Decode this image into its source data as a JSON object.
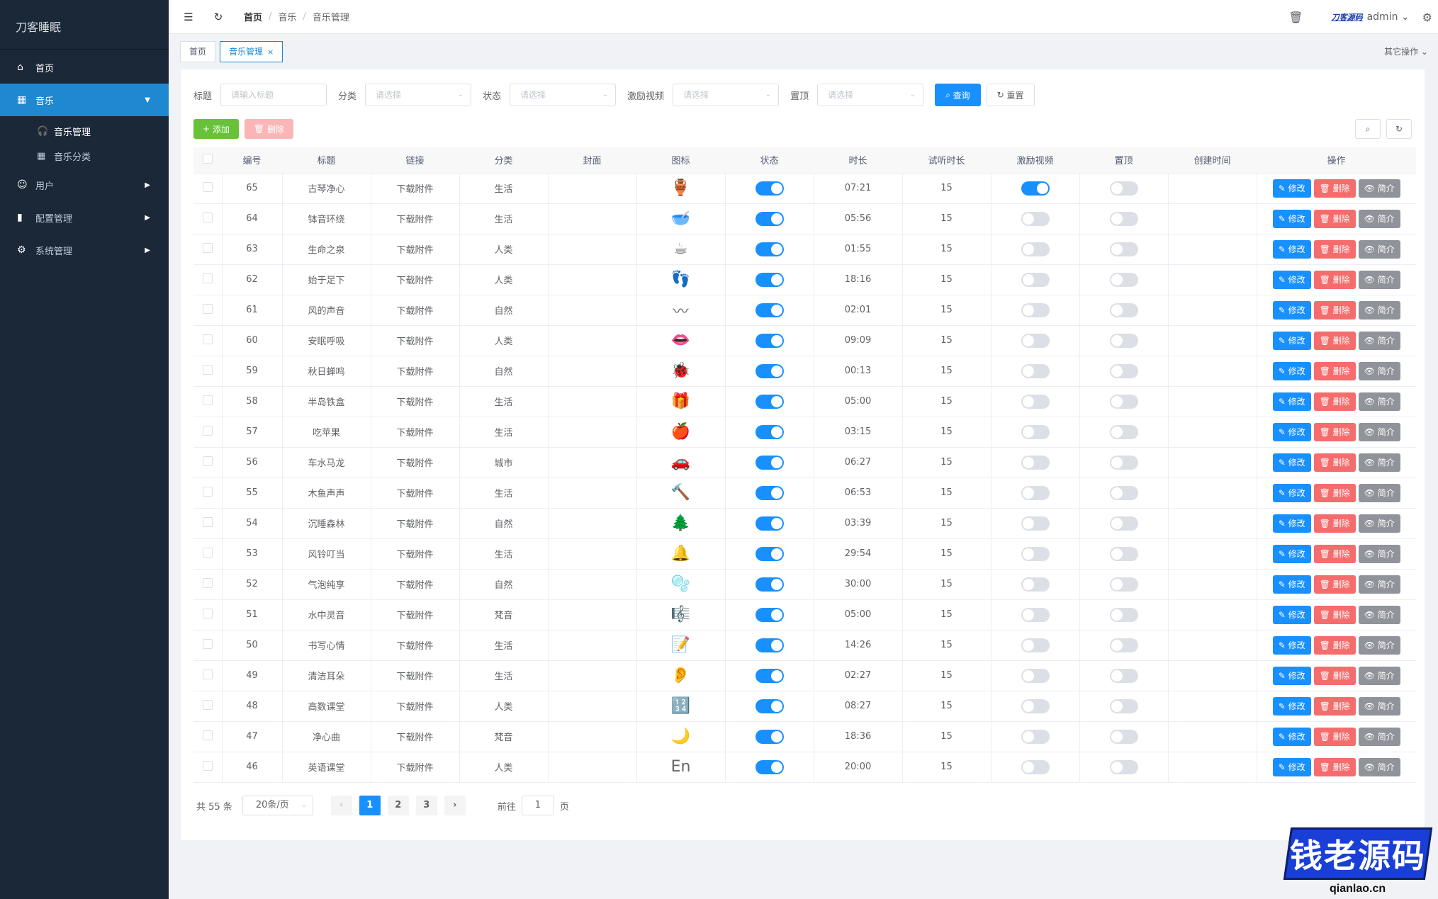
{
  "sidebar": {
    "logo": "刀客睡眠",
    "items": [
      {
        "label": "首页",
        "icon": "home-icon"
      },
      {
        "label": "音乐",
        "icon": "grid-icon"
      },
      {
        "label": "用户",
        "icon": "user-icon"
      },
      {
        "label": "配置管理",
        "icon": "bar-chart-icon"
      },
      {
        "label": "系统管理",
        "icon": "gear-icon"
      }
    ],
    "sub_items": [
      {
        "label": "音乐管理",
        "icon": "headphones-icon"
      },
      {
        "label": "音乐分类",
        "icon": "table-icon"
      }
    ]
  },
  "header": {
    "breadcrumb": [
      "首页",
      "音乐",
      "音乐管理"
    ],
    "brand": "刀客源码",
    "user": "admin"
  },
  "tags": {
    "items": [
      "首页",
      "音乐管理"
    ],
    "other_ops": "其它操作"
  },
  "filter": {
    "title_label": "标题",
    "title_placeholder": "请输入标题",
    "category_label": "分类",
    "status_label": "状态",
    "video_label": "激励视频",
    "top_label": "置顶",
    "select_placeholder": "请选择",
    "search_btn": "查询",
    "reset_btn": "重置"
  },
  "toolbar": {
    "add_btn": "添加",
    "delete_btn": "删除"
  },
  "table": {
    "headers": [
      "编号",
      "标题",
      "链接",
      "分类",
      "封面",
      "图标",
      "状态",
      "时长",
      "试听时长",
      "激励视频",
      "置顶",
      "创建时间",
      "操作"
    ],
    "link_text": "下载附件",
    "edit_btn": "修改",
    "delete_btn": "删除",
    "info_btn": "简介",
    "rows": [
      {
        "id": "65",
        "title": "古琴净心",
        "cat": "生活",
        "icon": "🏺",
        "status": true,
        "dur": "07:21",
        "trial": "15",
        "video": true,
        "top": false
      },
      {
        "id": "64",
        "title": "钵音环绕",
        "cat": "生活",
        "icon": "🥣",
        "status": true,
        "dur": "05:56",
        "trial": "15",
        "video": false,
        "top": false
      },
      {
        "id": "63",
        "title": "生命之泉",
        "cat": "人类",
        "icon": "☕",
        "status": true,
        "dur": "01:55",
        "trial": "15",
        "video": false,
        "top": false
      },
      {
        "id": "62",
        "title": "始于足下",
        "cat": "人类",
        "icon": "👣",
        "status": true,
        "dur": "18:16",
        "trial": "15",
        "video": false,
        "top": false
      },
      {
        "id": "61",
        "title": "风的声音",
        "cat": "自然",
        "icon": "〰",
        "status": true,
        "dur": "02:01",
        "trial": "15",
        "video": false,
        "top": false
      },
      {
        "id": "60",
        "title": "安眠呼吸",
        "cat": "人类",
        "icon": "👄",
        "status": true,
        "dur": "09:09",
        "trial": "15",
        "video": false,
        "top": false
      },
      {
        "id": "59",
        "title": "秋日蝉鸣",
        "cat": "自然",
        "icon": "🐞",
        "status": true,
        "dur": "00:13",
        "trial": "15",
        "video": false,
        "top": false
      },
      {
        "id": "58",
        "title": "半岛铁盒",
        "cat": "生活",
        "icon": "🎁",
        "status": true,
        "dur": "05:00",
        "trial": "15",
        "video": false,
        "top": false
      },
      {
        "id": "57",
        "title": "吃苹果",
        "cat": "生活",
        "icon": "🍎",
        "status": true,
        "dur": "03:15",
        "trial": "15",
        "video": false,
        "top": false
      },
      {
        "id": "56",
        "title": "车水马龙",
        "cat": "城市",
        "icon": "🚗",
        "status": true,
        "dur": "06:27",
        "trial": "15",
        "video": false,
        "top": false
      },
      {
        "id": "55",
        "title": "木鱼声声",
        "cat": "生活",
        "icon": "🔨",
        "status": true,
        "dur": "06:53",
        "trial": "15",
        "video": false,
        "top": false
      },
      {
        "id": "54",
        "title": "沉睡森林",
        "cat": "自然",
        "icon": "🌲",
        "status": true,
        "dur": "03:39",
        "trial": "15",
        "video": false,
        "top": false
      },
      {
        "id": "53",
        "title": "风铃叮当",
        "cat": "生活",
        "icon": "🔔",
        "status": true,
        "dur": "29:54",
        "trial": "15",
        "video": false,
        "top": false
      },
      {
        "id": "52",
        "title": "气泡纯享",
        "cat": "自然",
        "icon": "🫧",
        "status": true,
        "dur": "30:00",
        "trial": "15",
        "video": false,
        "top": false
      },
      {
        "id": "51",
        "title": "水中灵音",
        "cat": "梵音",
        "icon": "🎼",
        "status": true,
        "dur": "05:00",
        "trial": "15",
        "video": false,
        "top": false
      },
      {
        "id": "50",
        "title": "书写心情",
        "cat": "生活",
        "icon": "📝",
        "status": true,
        "dur": "14:26",
        "trial": "15",
        "video": false,
        "top": false
      },
      {
        "id": "49",
        "title": "清洁耳朵",
        "cat": "生活",
        "icon": "👂",
        "status": true,
        "dur": "02:27",
        "trial": "15",
        "video": false,
        "top": false
      },
      {
        "id": "48",
        "title": "高数课堂",
        "cat": "人类",
        "icon": "🔢",
        "status": true,
        "dur": "08:27",
        "trial": "15",
        "video": false,
        "top": false
      },
      {
        "id": "47",
        "title": "净心曲",
        "cat": "梵音",
        "icon": "🌙",
        "status": true,
        "dur": "18:36",
        "trial": "15",
        "video": false,
        "top": false
      },
      {
        "id": "46",
        "title": "英语课堂",
        "cat": "人类",
        "icon": "En",
        "status": true,
        "dur": "20:00",
        "trial": "15",
        "video": false,
        "top": false
      }
    ]
  },
  "pagination": {
    "total": "共 55 条",
    "page_size": "20条/页",
    "pages": [
      "1",
      "2",
      "3"
    ],
    "goto_label": "前往",
    "goto_value": "1",
    "page_suffix": "页"
  },
  "watermark": {
    "text": "钱老源码",
    "url": "qianlao.cn"
  }
}
